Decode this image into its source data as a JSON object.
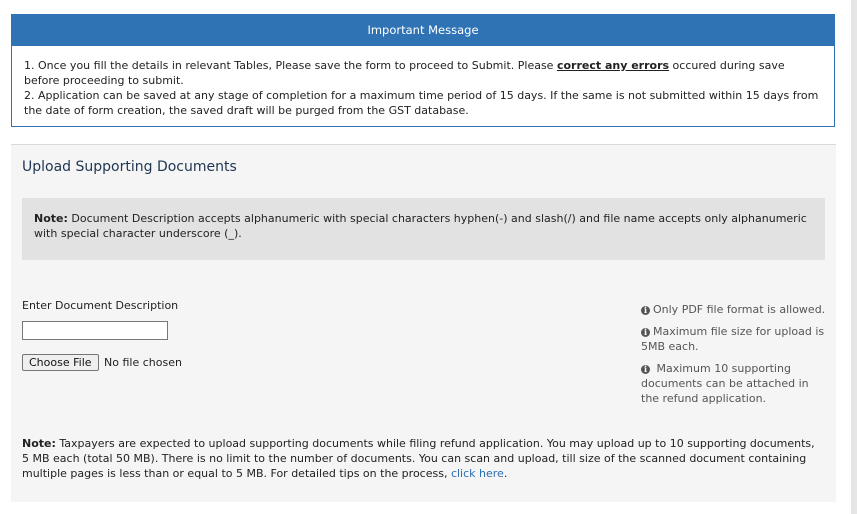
{
  "important_message": {
    "title": "Important Message",
    "line1_pre": "1. Once you fill the details in relevant Tables, Please save the form to proceed to Submit. Please ",
    "line1_link": "correct any errors",
    "line1_post": " occured during save before proceeding to submit.",
    "line2": "2. Application can be saved at any stage of completion for a maximum time period of 15 days. If the same is not submitted within 15 days from the date of form creation, the saved draft will be purged from the GST database."
  },
  "upload": {
    "title": "Upload Supporting Documents",
    "note_label": "Note:",
    "note_text": " Document Description accepts alphanumeric with special characters hyphen(-) and slash(/) and file name accepts only alphanumeric with special character underscore (_).",
    "description_label": "Enter Document Description",
    "description_value": "",
    "choose_file_label": "Choose File",
    "no_file_text": "No file chosen",
    "tips": [
      {
        "icon": "info-icon",
        "text": "Only PDF file format is allowed."
      },
      {
        "icon": "info-icon",
        "text": "Maximum file size for upload is 5MB each."
      },
      {
        "icon": "info-icon",
        "text": " Maximum 10 supporting documents can be attached in the refund application."
      }
    ],
    "bottom_note_label": "Note:",
    "bottom_note_text": " Taxpayers are expected to upload supporting documents while filing refund application. You may upload up to 10 supporting documents, 5 MB each (total 50 MB). There is no limit to the number of documents. You can scan and upload, till size of the scanned document containing multiple pages is less than or equal to 5 MB. For detailed tips on the process, ",
    "bottom_note_link": "click here",
    "bottom_note_end": "."
  },
  "colors": {
    "header_blue": "#2f73b4",
    "link_blue": "#2a6fb0",
    "panel_bg": "#f5f5f5",
    "note_bg": "#e2e2e2"
  }
}
